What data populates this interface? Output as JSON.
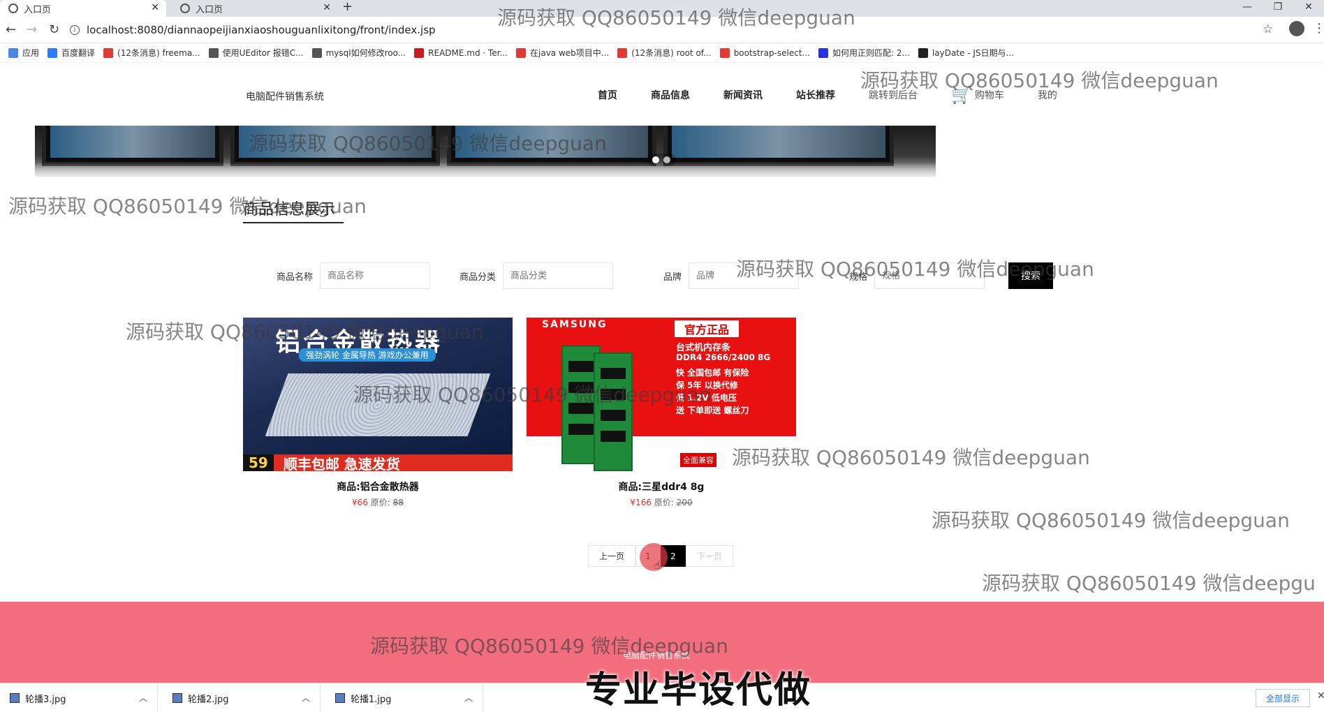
{
  "browser": {
    "tabs": [
      {
        "title": "入口页",
        "active": true
      },
      {
        "title": "入口页",
        "active": false
      }
    ],
    "new_tab": "+",
    "url": "localhost:8080/diannaopeijianxiaoshouguanlixitong/front/index.jsp",
    "bookmarks": [
      {
        "label": "应用",
        "icon": "apps-grid-icon",
        "color": "#4a86e8"
      },
      {
        "label": "百度翻译",
        "icon": "baidu-translate-icon",
        "color": "#2f7bf5"
      },
      {
        "label": "(12条消息) freema...",
        "icon": "csdn-icon",
        "color": "#e53935"
      },
      {
        "label": "使用UEditor 报错C...",
        "icon": "link-icon",
        "color": "#555555"
      },
      {
        "label": "mysql如何修改roo...",
        "icon": "link-icon",
        "color": "#555555"
      },
      {
        "label": "README.md · Ter...",
        "icon": "gitee-icon",
        "color": "#c71d23"
      },
      {
        "label": "在java web项目中...",
        "icon": "csdn-icon",
        "color": "#e53935"
      },
      {
        "label": "(12条消息) root of...",
        "icon": "csdn-icon",
        "color": "#e53935"
      },
      {
        "label": "bootstrap-select...",
        "icon": "bootstrap-icon",
        "color": "#e53935"
      },
      {
        "label": "如何用正则匹配: 2...",
        "icon": "baidu-icon",
        "color": "#2932e1"
      },
      {
        "label": "layDate - JS日期与...",
        "icon": "layui-icon",
        "color": "#222222"
      }
    ]
  },
  "site": {
    "logo": "电脑配件销售系统",
    "nav": [
      {
        "label": "首页",
        "bold": true
      },
      {
        "label": "商品信息",
        "bold": true
      },
      {
        "label": "新闻资讯",
        "bold": true
      },
      {
        "label": "站长推荐",
        "bold": true
      },
      {
        "label": "跳转到后台",
        "bold": false
      }
    ],
    "cart_label": "购物车",
    "mine_label": "我的",
    "section_title": "商品信息展示",
    "search": {
      "fields": [
        {
          "label": "商品名称",
          "placeholder": "商品名称"
        },
        {
          "label": "商品分类",
          "placeholder": "商品分类"
        },
        {
          "label": "品牌",
          "placeholder": "品牌"
        },
        {
          "label": "规格",
          "placeholder": "规格"
        }
      ],
      "button": "搜索"
    },
    "products": [
      {
        "name": "商品:铝合金散热器",
        "price": "¥66",
        "orig_label": "原价:",
        "orig_price": "88",
        "image_text": {
          "title": "铝合金散热器",
          "sub": "强劲涡轮 金属导热 游戏办公兼用",
          "price_tag": "59",
          "bar": "顺丰包邮 急速发货"
        }
      },
      {
        "name": "商品:三星ddr4 8g",
        "price": "¥166",
        "orig_label": "原价:",
        "orig_price": "200",
        "image_text": {
          "brand": "SAMSUNG",
          "badge": "官方正品",
          "l1": "台式机内存条",
          "l2": "DDR4 2666/2400 8G",
          "l3": "快 全国包邮 有保险",
          "l4": "保 5年 以换代修",
          "l5": "低 1.2V 低电压",
          "l6": "送 下单即送 螺丝刀",
          "bottom": "全面兼容"
        }
      }
    ],
    "pagination": {
      "prev": "上一页",
      "pages": [
        "1",
        "2"
      ],
      "current": "2",
      "next": "下一页"
    },
    "footer_text": "电脑配件销售系统"
  },
  "downloads": {
    "items": [
      {
        "name": "轮播3.jpg"
      },
      {
        "name": "轮播2.jpg"
      },
      {
        "name": "轮播1.jpg"
      }
    ],
    "show_all": "全部显示"
  },
  "overlay": {
    "watermark": "源码获取 QQ86050149 微信deepguan",
    "watermark_cut": "源码获取 QQ86050149 微信deepgu",
    "promo": "专业毕设代做"
  }
}
